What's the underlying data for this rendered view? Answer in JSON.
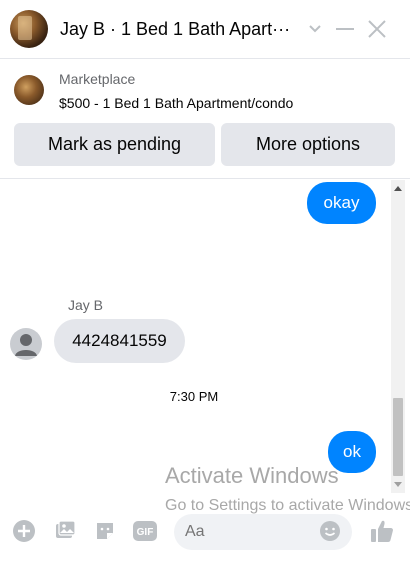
{
  "header": {
    "title": "Jay B · 1 Bed 1 Bath Apart···",
    "avatar_icon": "profile-photo",
    "controls": [
      "chevron-down-icon",
      "minimize-icon",
      "close-icon"
    ]
  },
  "marketplace": {
    "label": "Marketplace",
    "item": "$500 - 1 Bed 1 Bath Apartment/condo",
    "buttons": {
      "pending": "Mark as pending",
      "more": "More options"
    }
  },
  "messages": {
    "outgoing_1": "okay",
    "sender_name": "Jay B",
    "incoming_1": "4424841559",
    "timestamp": "7:30 PM",
    "outgoing_2": "ok"
  },
  "watermark": {
    "title": "Activate Windows",
    "subtitle": "Go to Settings to activate Windows."
  },
  "composer": {
    "placeholder": "Aa",
    "icons": [
      "plus-icon",
      "photo-icon",
      "sticker-icon",
      "gif-icon",
      "emoji-icon",
      "like-icon"
    ]
  },
  "colors": {
    "accent": "#0084ff",
    "incoming_bubble": "#e4e6eb",
    "icon_gray": "#bcc0c4"
  }
}
